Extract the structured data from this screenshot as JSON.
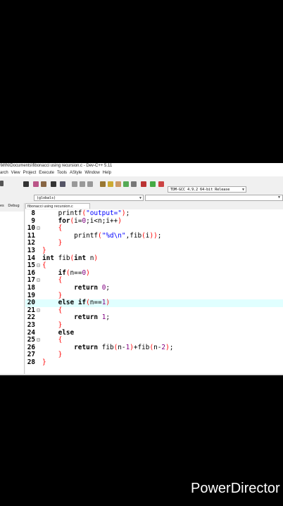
{
  "window": {
    "title": "\\MIN\\Documents\\fibonacci using recursion.c - Dev-C++ 5.11"
  },
  "menu": [
    "arch",
    "View",
    "Project",
    "Execute",
    "Tools",
    "AStyle",
    "Window",
    "Help"
  ],
  "toolbar": {
    "compiler": "TDM-GCC 4.9.2 64-bit Release",
    "scope": "(globals)"
  },
  "left_panel": {
    "tabs": [
      "es",
      "Debug"
    ]
  },
  "editor": {
    "file_tab": "fibonacci using recursion.c",
    "highlighted_line": 20,
    "lines": [
      {
        "n": "8",
        "fold": "",
        "text": "    printf(\"output=\");"
      },
      {
        "n": "9",
        "fold": "",
        "text": "    for(i=0;i<n;i++)"
      },
      {
        "n": "10",
        "fold": "⊟",
        "text": "    {"
      },
      {
        "n": "11",
        "fold": "",
        "text": "        printf(\"%d\\n\",fib(i));"
      },
      {
        "n": "12",
        "fold": "",
        "text": "    }"
      },
      {
        "n": "13",
        "fold": "",
        "text": "}"
      },
      {
        "n": "14",
        "fold": "",
        "text": "int fib(int n)"
      },
      {
        "n": "15",
        "fold": "⊟",
        "text": "{"
      },
      {
        "n": "16",
        "fold": "",
        "text": "    if(n==0)"
      },
      {
        "n": "17",
        "fold": "⊟",
        "text": "    {"
      },
      {
        "n": "18",
        "fold": "",
        "text": "        return 0;"
      },
      {
        "n": "19",
        "fold": "",
        "text": "    }"
      },
      {
        "n": "20",
        "fold": "",
        "text": "    else if(n==1)"
      },
      {
        "n": "21",
        "fold": "⊟",
        "text": "    {"
      },
      {
        "n": "22",
        "fold": "",
        "text": "        return 1;"
      },
      {
        "n": "23",
        "fold": "",
        "text": "    }"
      },
      {
        "n": "24",
        "fold": "",
        "text": "    else"
      },
      {
        "n": "25",
        "fold": "⊟",
        "text": "    {"
      },
      {
        "n": "26",
        "fold": "",
        "text": "        return fib(n-1)+fib(n-2);"
      },
      {
        "n": "27",
        "fold": "",
        "text": "    }"
      },
      {
        "n": "28",
        "fold": "",
        "text": "}"
      }
    ]
  },
  "watermark": "PowerDirector"
}
